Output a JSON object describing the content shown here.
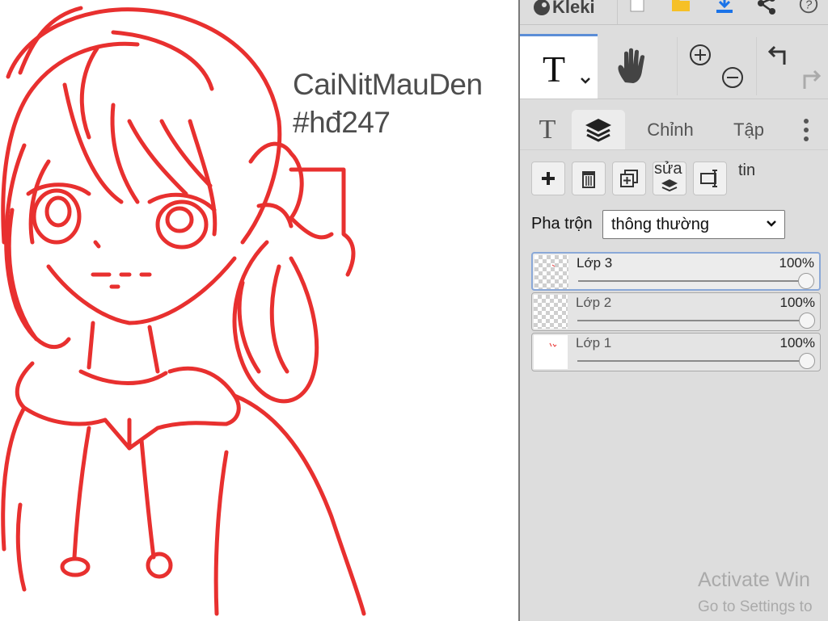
{
  "canvas": {
    "text_line_1": "CaiNitMauDen",
    "text_line_2": "#hđ247",
    "stroke_color": "#e8302f"
  },
  "topbar": {
    "app_name": "Kleki",
    "icons": [
      "logo-icon",
      "new-document-icon",
      "open-folder-icon",
      "download-icon",
      "share-icon",
      "help-icon"
    ]
  },
  "tools": {
    "active_tool": "text",
    "text_tool_glyph": "T",
    "icons": [
      "text-tool-icon",
      "hand-tool-icon",
      "zoom-in-icon",
      "zoom-out-icon",
      "undo-icon",
      "redo-icon"
    ]
  },
  "tabs": {
    "text_tab_glyph": "T",
    "layers_tab_icon": "layers-icon",
    "edit_label": "Chỉnh",
    "file_label": "Tập",
    "more_icon": "more-vertical-icon",
    "active": "layers"
  },
  "layer_panel": {
    "merge_label": "sửa",
    "extra_label": "tin",
    "blend_label": "Pha trộn",
    "blend_value": "thông thường",
    "layers": [
      {
        "name": "Lớp 3",
        "opacity": "100%",
        "active": true
      },
      {
        "name": "Lớp 2",
        "opacity": "100%",
        "active": false
      },
      {
        "name": "Lớp 1",
        "opacity": "100%",
        "active": false
      }
    ]
  },
  "watermark": {
    "line1": "Activate Win",
    "line2": "Go to Settings to"
  },
  "colors": {
    "panel_bg": "#dddddd",
    "accent": "#5b8dd6",
    "drawing_red": "#e8302f"
  }
}
